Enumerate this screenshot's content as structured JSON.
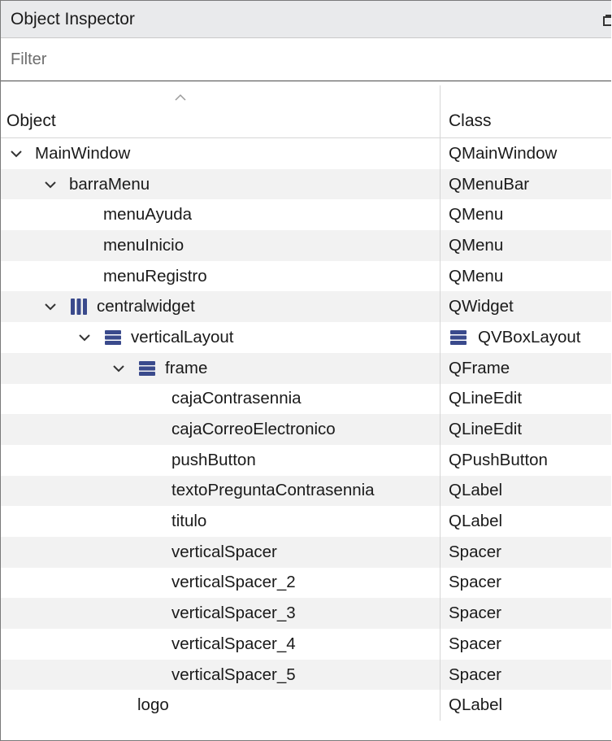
{
  "panel": {
    "title": "Object Inspector",
    "filter": {
      "placeholder": "Filter",
      "value": ""
    }
  },
  "columns": {
    "object": "Object",
    "class": "Class"
  },
  "rows": [
    {
      "name": "MainWindow",
      "class": "QMainWindow",
      "depth": 0,
      "expanded": true,
      "icon": ""
    },
    {
      "name": "barraMenu",
      "class": "QMenuBar",
      "depth": 1,
      "expanded": true,
      "icon": ""
    },
    {
      "name": "menuAyuda",
      "class": "QMenu",
      "depth": 2,
      "expanded": null,
      "icon": ""
    },
    {
      "name": "menuInicio",
      "class": "QMenu",
      "depth": 2,
      "expanded": null,
      "icon": ""
    },
    {
      "name": "menuRegistro",
      "class": "QMenu",
      "depth": 2,
      "expanded": null,
      "icon": ""
    },
    {
      "name": "centralwidget",
      "class": "QWidget",
      "depth": 1,
      "expanded": true,
      "icon": "hbox-layout-icon"
    },
    {
      "name": "verticalLayout",
      "class": "QVBoxLayout",
      "depth": 2,
      "expanded": true,
      "icon": "vbox-layout-icon",
      "class_icon": "vbox-layout-icon"
    },
    {
      "name": "frame",
      "class": "QFrame",
      "depth": 3,
      "expanded": true,
      "icon": "vbox-layout-icon"
    },
    {
      "name": "cajaContrasennia",
      "class": "QLineEdit",
      "depth": 4,
      "expanded": null,
      "icon": ""
    },
    {
      "name": "cajaCorreoElectronico",
      "class": "QLineEdit",
      "depth": 4,
      "expanded": null,
      "icon": ""
    },
    {
      "name": "pushButton",
      "class": "QPushButton",
      "depth": 4,
      "expanded": null,
      "icon": ""
    },
    {
      "name": "textoPreguntaContrasennia",
      "class": "QLabel",
      "depth": 4,
      "expanded": null,
      "icon": ""
    },
    {
      "name": "titulo",
      "class": "QLabel",
      "depth": 4,
      "expanded": null,
      "icon": ""
    },
    {
      "name": "verticalSpacer",
      "class": "Spacer",
      "depth": 4,
      "expanded": null,
      "icon": ""
    },
    {
      "name": "verticalSpacer_2",
      "class": "Spacer",
      "depth": 4,
      "expanded": null,
      "icon": ""
    },
    {
      "name": "verticalSpacer_3",
      "class": "Spacer",
      "depth": 4,
      "expanded": null,
      "icon": ""
    },
    {
      "name": "verticalSpacer_4",
      "class": "Spacer",
      "depth": 4,
      "expanded": null,
      "icon": ""
    },
    {
      "name": "verticalSpacer_5",
      "class": "Spacer",
      "depth": 4,
      "expanded": null,
      "icon": ""
    },
    {
      "name": "logo",
      "class": "QLabel",
      "depth": 3,
      "expanded": null,
      "icon": ""
    }
  ],
  "colors": {
    "layout_icon": "#3a4a8c",
    "header_bg": "#e9eaec",
    "alt_row": "#f2f2f2"
  }
}
